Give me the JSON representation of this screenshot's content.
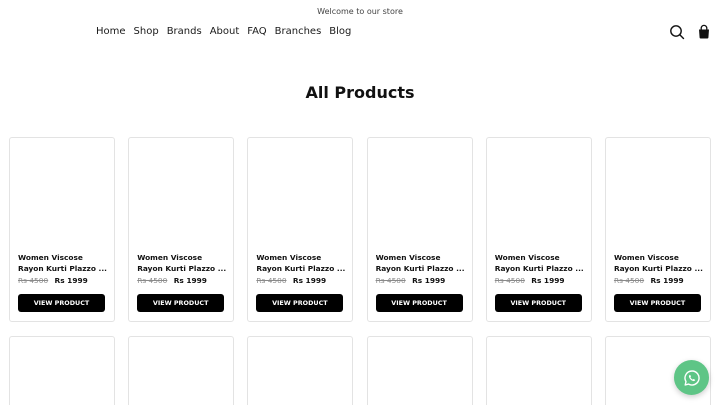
{
  "announcement": "Welcome to our store",
  "nav": {
    "items": [
      "Home",
      "Shop",
      "Brands",
      "About",
      "FAQ",
      "Branches",
      "Blog"
    ]
  },
  "header_icons": {
    "search": "search-icon",
    "bag": "shopping-bag-icon"
  },
  "page_title": "All Products",
  "products": [
    {
      "title_line1": "Women Viscose",
      "title_line2": "Rayon Kurti Plazzo ...",
      "price_old": "Rs 4500",
      "price_new": "Rs 1999",
      "button": "VIEW PRODUCT"
    },
    {
      "title_line1": "Women Viscose",
      "title_line2": "Rayon Kurti Plazzo ...",
      "price_old": "Rs 4500",
      "price_new": "Rs 1999",
      "button": "VIEW PRODUCT"
    },
    {
      "title_line1": "Women Viscose",
      "title_line2": "Rayon Kurti Plazzo ...",
      "price_old": "Rs 4500",
      "price_new": "Rs 1999",
      "button": "VIEW PRODUCT"
    },
    {
      "title_line1": "Women Viscose",
      "title_line2": "Rayon Kurti Plazzo ...",
      "price_old": "Rs 4500",
      "price_new": "Rs 1999",
      "button": "VIEW PRODUCT"
    },
    {
      "title_line1": "Women Viscose",
      "title_line2": "Rayon Kurti Plazzo ...",
      "price_old": "Rs 4500",
      "price_new": "Rs 1999",
      "button": "VIEW PRODUCT"
    },
    {
      "title_line1": "Women Viscose",
      "title_line2": "Rayon Kurti Plazzo ...",
      "price_old": "Rs 4500",
      "price_new": "Rs 1999",
      "button": "VIEW PRODUCT"
    }
  ],
  "chat_button": {
    "icon": "whatsapp-icon",
    "color": "#5ec586"
  },
  "colors": {
    "button_bg": "#000000",
    "card_border": "#e3e3e3"
  }
}
